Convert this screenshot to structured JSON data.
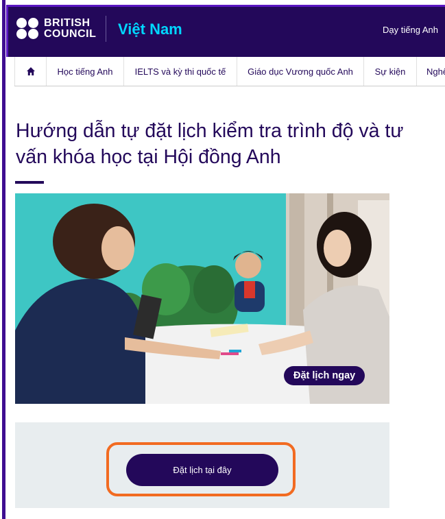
{
  "header": {
    "brand_line1": "BRITISH",
    "brand_line2": "COUNCIL",
    "country": "Việt Nam",
    "top_link": "Dạy tiếng Anh"
  },
  "nav": {
    "home_icon": "home-icon",
    "items": [
      "Học tiếng Anh",
      "IELTS và kỳ thi quốc tế",
      "Giáo dục Vương quốc Anh",
      "Sự kiện",
      "Nghệ"
    ]
  },
  "page": {
    "title": "Hướng dẫn tự đặt lịch kiểm tra trình độ và tư vấn khóa học tại Hội đồng Anh"
  },
  "hero": {
    "badge": "Đặt lịch ngay"
  },
  "cta": {
    "button_label": "Đặt lịch tại đây",
    "highlight_color": "#f26b21"
  },
  "colors": {
    "brand_purple": "#23085a",
    "accent_cyan": "#00d7ff",
    "panel_bg": "#e8edef"
  }
}
